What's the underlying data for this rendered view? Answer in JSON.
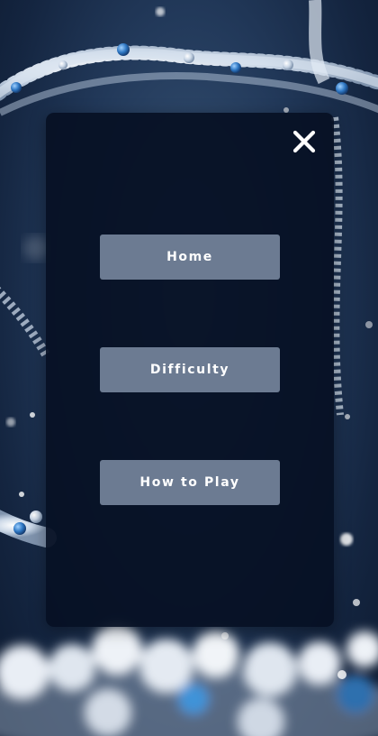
{
  "menu": {
    "close_icon": "close-icon",
    "items": [
      {
        "label": "Home"
      },
      {
        "label": "Difficulty"
      },
      {
        "label": "How to Play"
      }
    ]
  },
  "colors": {
    "panel": "#061024",
    "button": "#6c7b92",
    "button_text": "#ffffff",
    "close_icon": "#ffffff"
  }
}
